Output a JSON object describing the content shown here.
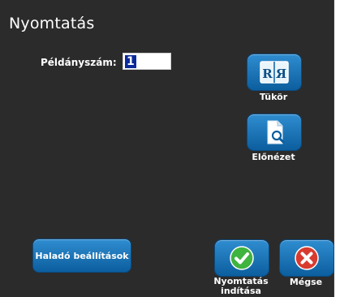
{
  "dialog": {
    "title": "Nyomtatás"
  },
  "copies": {
    "label": "Példányszám:",
    "value": "1"
  },
  "buttons": {
    "mirror": {
      "label": "Tükör",
      "icon": "mirror-icon",
      "glyph_left": "R",
      "glyph_right": "Я"
    },
    "preview": {
      "label": "Előnézet",
      "icon": "preview-icon"
    },
    "advanced": {
      "label": "Haladó beállítások"
    },
    "start_print": {
      "label": "Nyomtatás indítása",
      "icon": "check-icon"
    },
    "cancel": {
      "label": "Mégse",
      "icon": "close-icon"
    }
  },
  "colors": {
    "background": "#2b2b2b",
    "button_blue": "#1a73b8",
    "confirm_green": "#3fb43f",
    "cancel_red": "#d93a2f",
    "selection": "#0a2a9a"
  }
}
